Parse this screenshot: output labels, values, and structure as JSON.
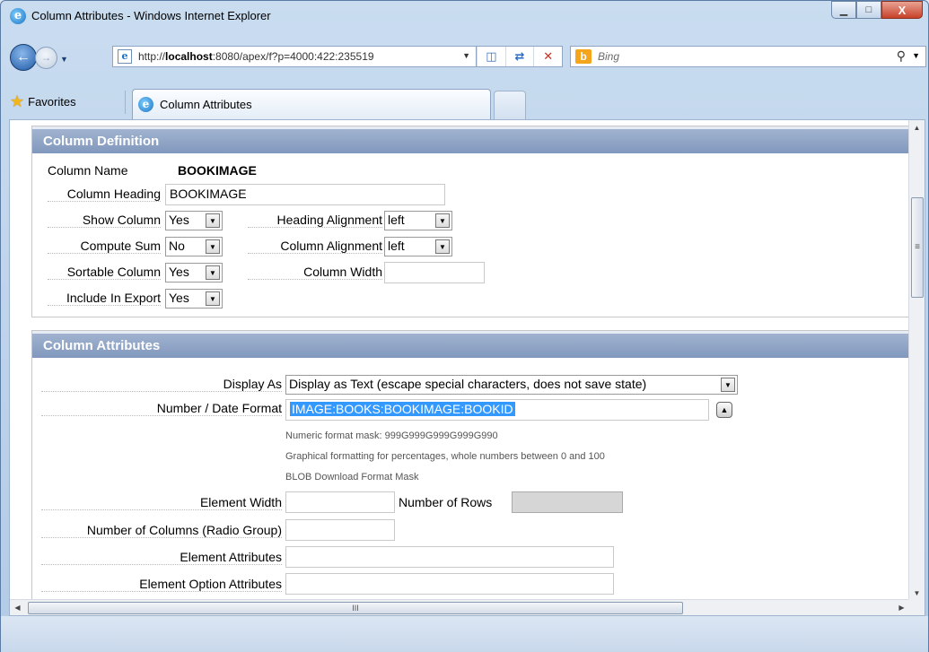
{
  "window": {
    "title": "Column Attributes - Windows Internet Explorer",
    "minimize_glyph": "▁",
    "maximize_glyph": "□",
    "close_glyph": "X"
  },
  "nav": {
    "url_prefix": "http://",
    "url_host": "localhost",
    "url_rest": ":8080/apex/f?p=4000:422:235519",
    "search_placeholder": "Bing"
  },
  "tabs": {
    "favorites_label": "Favorites",
    "active_tab_label": "Column Attributes"
  },
  "icons": {
    "back": "back-arrow-icon",
    "forward": "forward-arrow-icon",
    "compat": "compatibility-view-icon",
    "refresh": "refresh-icon",
    "stop": "stop-icon",
    "search": "magnifier-icon",
    "favorites": "star-icon",
    "ie": "internet-explorer-icon"
  },
  "column_definition": {
    "title": "Column Definition",
    "column_name_label": "Column Name",
    "column_name_value": "BOOKIMAGE",
    "column_heading_label": "Column Heading",
    "column_heading_value": "BOOKIMAGE",
    "show_column_label": "Show Column",
    "show_column_value": "Yes",
    "compute_sum_label": "Compute Sum",
    "compute_sum_value": "No",
    "sortable_column_label": "Sortable Column",
    "sortable_column_value": "Yes",
    "include_in_export_label": "Include In Export",
    "include_in_export_value": "Yes",
    "heading_alignment_label": "Heading Alignment",
    "heading_alignment_value": "left",
    "column_alignment_label": "Column Alignment",
    "column_alignment_value": "left",
    "column_width_label": "Column Width",
    "column_width_value": ""
  },
  "column_attributes": {
    "title": "Column Attributes",
    "display_as_label": "Display As",
    "display_as_value": "Display as Text (escape special characters, does not save state)",
    "number_date_format_label": "Number / Date Format",
    "number_date_format_value": "IMAGE:BOOKS:BOOKIMAGE:BOOKID",
    "hint_numeric": "Numeric format mask: 999G999G999G999G990",
    "hint_graphical": "Graphical formatting for percentages, whole numbers between 0 and 100",
    "hint_blob": "BLOB Download Format Mask",
    "element_width_label": "Element Width",
    "element_width_value": "",
    "number_of_rows_label": "Number of Rows",
    "number_of_rows_value": "",
    "number_of_columns_label": "Number of Columns (Radio Group)",
    "number_of_columns_value": "",
    "element_attributes_label": "Element Attributes",
    "element_attributes_value": "",
    "element_option_attributes_label": "Element Option Attributes",
    "element_option_attributes_value": ""
  },
  "scrollbar": {
    "grip_glyph": "≡",
    "h_grip_glyph": "III"
  },
  "colors": {
    "region_header": "#8198bd",
    "selection": "#3399ff"
  }
}
